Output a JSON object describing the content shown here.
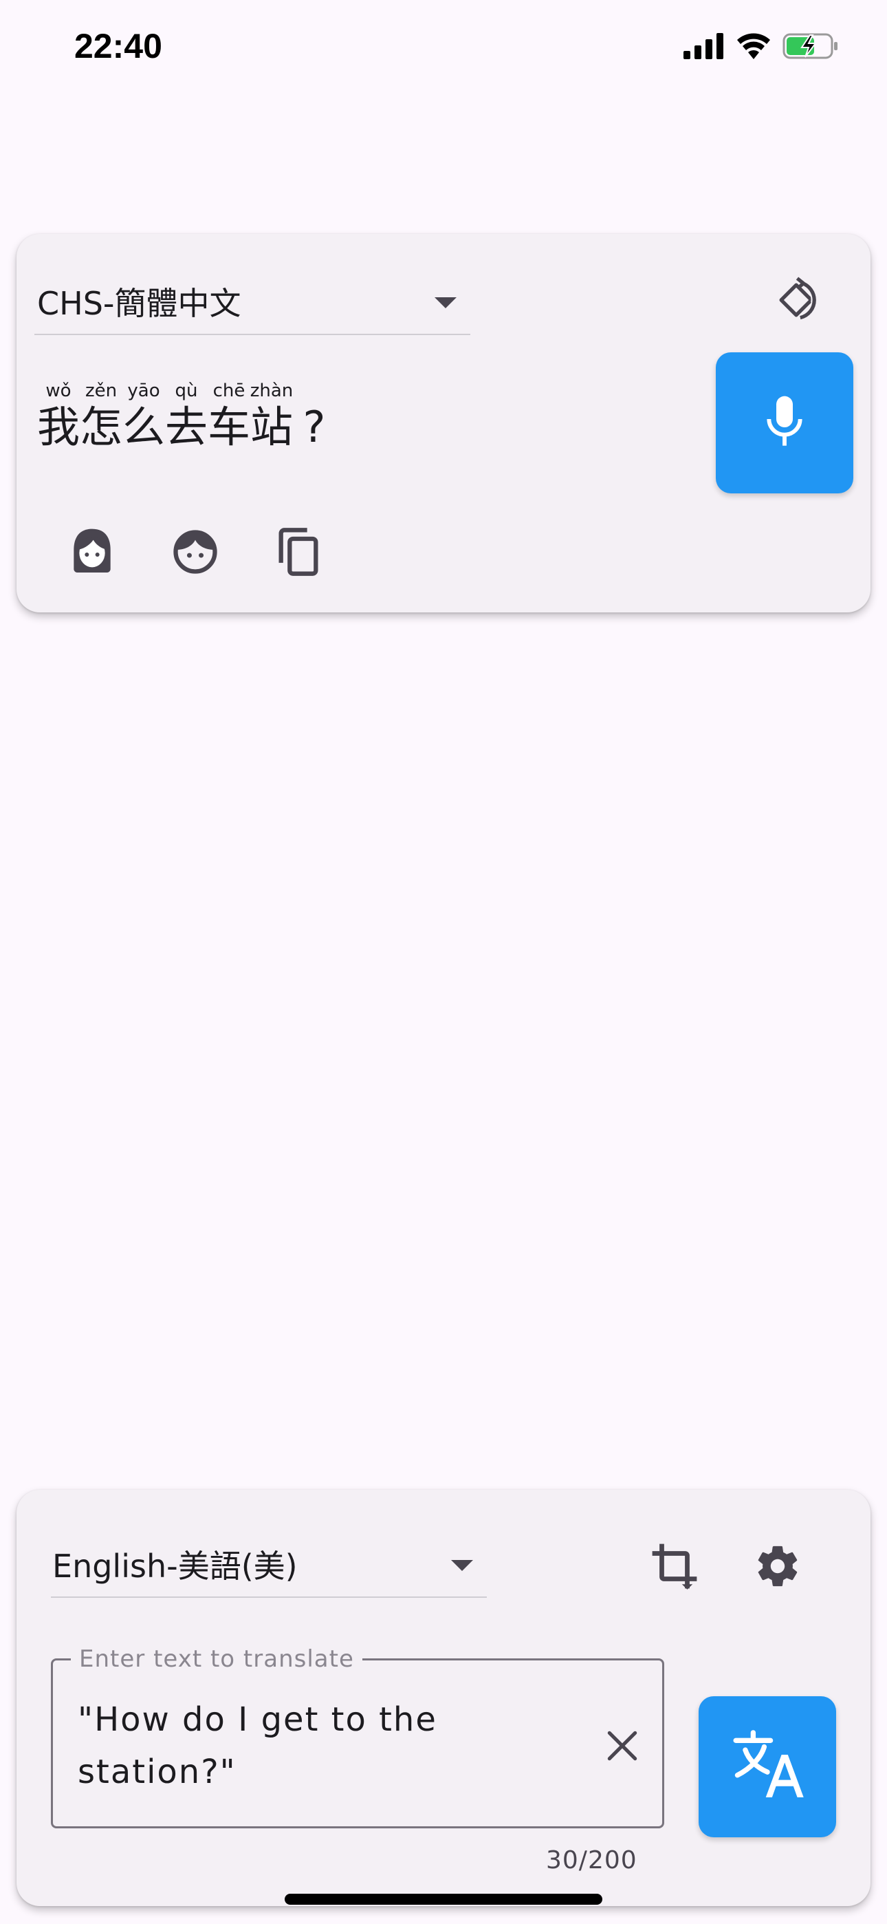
{
  "status_bar": {
    "time": "22:40",
    "icons": [
      "cellular-signal-icon",
      "wifi-icon",
      "battery-charging-icon"
    ]
  },
  "source_panel": {
    "language": "CHS-簡體中文",
    "rotate_icon": "rotate-icon",
    "characters": [
      {
        "char": "我",
        "pinyin": "wǒ"
      },
      {
        "char": "怎",
        "pinyin": "zěn"
      },
      {
        "char": "么",
        "pinyin": "yāo"
      },
      {
        "char": "去",
        "pinyin": "qù"
      },
      {
        "char": "车",
        "pinyin": "chē"
      },
      {
        "char": "站",
        "pinyin": "zhàn"
      },
      {
        "char": "?",
        "pinyin": ""
      }
    ],
    "actions": [
      "female-voice-icon",
      "child-voice-icon",
      "copy-icon"
    ],
    "mic_icon": "microphone-icon"
  },
  "target_panel": {
    "language": "English-美語(美)",
    "crop_icon": "crop-icon",
    "settings_icon": "settings-icon",
    "input": {
      "label": "Enter text to translate",
      "value": "\"How do I get to the station?\""
    },
    "counter": "30/200",
    "translate_icon": "translate-icon"
  },
  "colors": {
    "accent": "#2196f3",
    "background": "#fdf8fe",
    "card": "#f4f0f5",
    "icon": "#49454f"
  }
}
